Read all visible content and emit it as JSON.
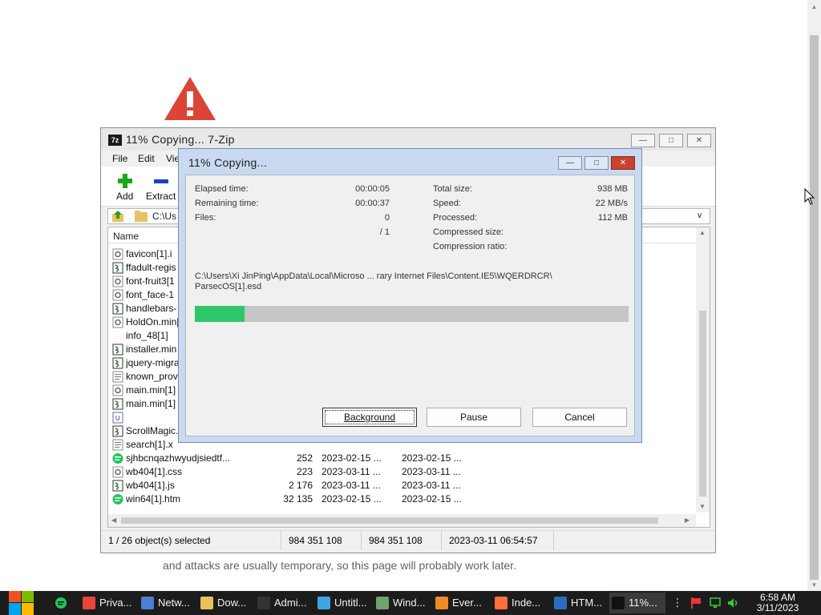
{
  "browser": {
    "message": "and attacks are usually temporary, so this page will probably work later."
  },
  "zip": {
    "title": "11% Copying... 7-Zip",
    "menu": [
      "File",
      "Edit",
      "Vie"
    ],
    "toolbar": {
      "add": "Add",
      "extract": "Extract"
    },
    "address": "C:\\Us",
    "column_name": "Name",
    "files": [
      {
        "name": "favicon[1].i",
        "size": "",
        "modified": "",
        "created": "",
        "icon": "gear"
      },
      {
        "name": "ffadult-regis",
        "size": "",
        "modified": "",
        "created": "",
        "icon": "script"
      },
      {
        "name": "font-fruit3[1",
        "size": "",
        "modified": "",
        "created": "",
        "icon": "gear"
      },
      {
        "name": "font_face-1",
        "size": "",
        "modified": "",
        "created": "",
        "icon": "gear"
      },
      {
        "name": "handlebars-",
        "size": "",
        "modified": "",
        "created": "",
        "icon": "script"
      },
      {
        "name": "HoldOn.min[",
        "size": "",
        "modified": "",
        "created": "",
        "icon": "gear"
      },
      {
        "name": "info_48[1]",
        "size": "",
        "modified": "",
        "created": "",
        "icon": "none"
      },
      {
        "name": "installer.min",
        "size": "",
        "modified": "",
        "created": "",
        "icon": "script"
      },
      {
        "name": "jquery-migra",
        "size": "",
        "modified": "",
        "created": "",
        "icon": "script"
      },
      {
        "name": "known_prov",
        "size": "",
        "modified": "",
        "created": "",
        "icon": "doc"
      },
      {
        "name": "main.min[1]",
        "size": "",
        "modified": "",
        "created": "",
        "icon": "gear"
      },
      {
        "name": "main.min[1]",
        "size": "",
        "modified": "",
        "created": "",
        "icon": "script"
      },
      {
        "name": "",
        "size": "",
        "modified": "",
        "created": "",
        "icon": "url"
      },
      {
        "name": "ScrollMagic.",
        "size": "",
        "modified": "",
        "created": "",
        "icon": "script"
      },
      {
        "name": "search[1].x",
        "size": "",
        "modified": "",
        "created": "",
        "icon": "doc"
      },
      {
        "name": "sjhbcnqazhwyudjsiedtf...",
        "size": "252",
        "modified": "2023-02-15 ...",
        "created": "2023-02-15 ...",
        "icon": "htm"
      },
      {
        "name": "wb404[1].css",
        "size": "223",
        "modified": "2023-03-11 ...",
        "created": "2023-03-11 ...",
        "icon": "gear"
      },
      {
        "name": "wb404[1].js",
        "size": "2 176",
        "modified": "2023-03-11 ...",
        "created": "2023-03-11 ...",
        "icon": "script"
      },
      {
        "name": "win64[1].htm",
        "size": "32 135",
        "modified": "2023-02-15 ...",
        "created": "2023-02-15 ...",
        "icon": "htm"
      }
    ],
    "status": {
      "selected": "1 / 26 object(s) selected",
      "size1": "984 351 108",
      "size2": "984 351 108",
      "date": "2023-03-11 06:54:57"
    }
  },
  "dialog": {
    "title": "11% Copying...",
    "elapsed_label": "Elapsed time:",
    "elapsed_value": "00:00:05",
    "remaining_label": "Remaining time:",
    "remaining_value": "00:00:37",
    "files_label": "Files:",
    "files_value": "0",
    "files_total": "/ 1",
    "total_size_label": "Total size:",
    "total_size_value": "938 MB",
    "speed_label": "Speed:",
    "speed_value": "22 MB/s",
    "processed_label": "Processed:",
    "processed_value": "112 MB",
    "compressed_label": "Compressed size:",
    "ratio_label": "Compression ratio:",
    "path_line1": "C:\\Users\\Xi JinPing\\AppData\\Local\\Microso ... rary Internet Files\\Content.IE5\\WQERDRCR\\",
    "path_line2": "ParsecOS[1].esd",
    "progress": 0.115,
    "progress_color": "#2ec869",
    "buttons": {
      "background": "Background",
      "pause": "Pause",
      "cancel": "Cancel"
    }
  },
  "taskbar": {
    "items": [
      {
        "label": "Priva...",
        "icon": "chrome-icon",
        "color": "#e8453c"
      },
      {
        "label": "Netw...",
        "icon": "network-icon",
        "color": "#4a7fd4"
      },
      {
        "label": "Dow...",
        "icon": "folder-icon",
        "color": "#e8c15a"
      },
      {
        "label": "Admi...",
        "icon": "cmd-icon",
        "color": "#333333"
      },
      {
        "label": "Untitl...",
        "icon": "notepad-icon",
        "color": "#3fa4e0"
      },
      {
        "label": "Wind...",
        "icon": "window-icon",
        "color": "#6fa36f"
      },
      {
        "label": "Ever...",
        "icon": "everything-icon",
        "color": "#f08a24"
      },
      {
        "label": "Inde...",
        "icon": "firefox-icon",
        "color": "#ff7139"
      },
      {
        "label": "HTM...",
        "icon": "htm-icon",
        "color": "#2b6cbf"
      },
      {
        "label": "11%...",
        "icon": "7zip-icon",
        "color": "#111111"
      }
    ],
    "time": "6:58 AM",
    "date": "3/11/2023"
  }
}
